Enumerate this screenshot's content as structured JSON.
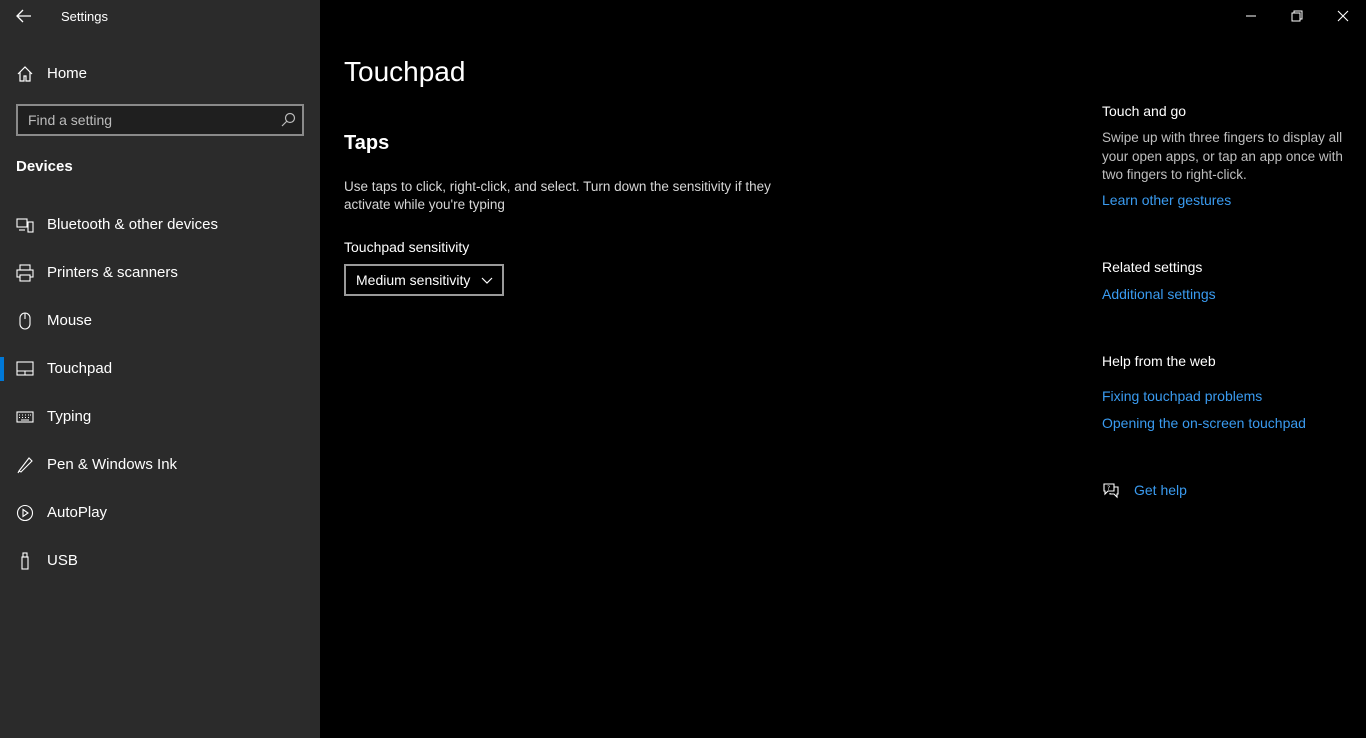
{
  "app": {
    "title": "Settings"
  },
  "window": {
    "minimize": "minimize",
    "restore": "restore",
    "close": "close"
  },
  "sidebar": {
    "home_label": "Home",
    "search_placeholder": "Find a setting",
    "section": "Devices",
    "items": [
      {
        "label": "Bluetooth & other devices",
        "icon": "bluetooth-devices-icon",
        "selected": false
      },
      {
        "label": "Printers & scanners",
        "icon": "printer-icon",
        "selected": false
      },
      {
        "label": "Mouse",
        "icon": "mouse-icon",
        "selected": false
      },
      {
        "label": "Touchpad",
        "icon": "touchpad-icon",
        "selected": true
      },
      {
        "label": "Typing",
        "icon": "keyboard-icon",
        "selected": false
      },
      {
        "label": "Pen & Windows Ink",
        "icon": "pen-icon",
        "selected": false
      },
      {
        "label": "AutoPlay",
        "icon": "autoplay-icon",
        "selected": false
      },
      {
        "label": "USB",
        "icon": "usb-icon",
        "selected": false
      }
    ]
  },
  "main": {
    "title": "Touchpad",
    "taps_heading": "Taps",
    "taps_description": "Use taps to click, right-click, and select. Turn down the sensitivity if they activate while you're typing",
    "sensitivity_label": "Touchpad sensitivity",
    "sensitivity_value": "Medium sensitivity"
  },
  "right": {
    "touch_heading": "Touch and go",
    "touch_text": "Swipe up with three fingers to display all your open apps, or tap an app once with two fingers to right-click.",
    "touch_link": "Learn other gestures",
    "related_heading": "Related settings",
    "related_link": "Additional settings",
    "help_heading": "Help from the web",
    "help_links": [
      "Fixing touchpad problems",
      "Opening the on-screen touchpad"
    ],
    "get_help": "Get help"
  },
  "colors": {
    "accent": "#0078d7",
    "link": "#3a9bf0",
    "sidebar_bg": "#2b2b2b",
    "main_bg": "#000000"
  }
}
